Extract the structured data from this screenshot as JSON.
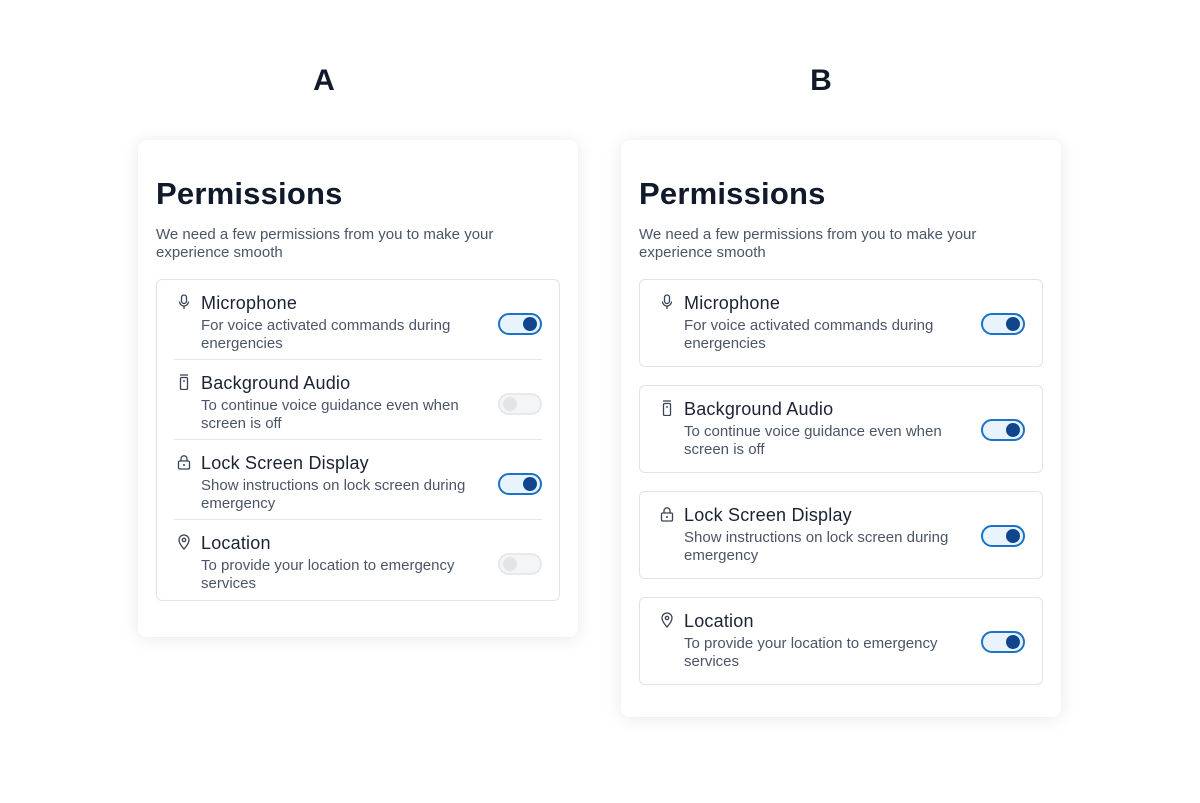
{
  "variants": [
    {
      "label": "A",
      "title": "Permissions",
      "subtitle": "We need a few permissions from you to make your experience smooth",
      "items": [
        {
          "name": "Microphone",
          "description": "For voice activated commands during energencies",
          "icon": "microphone-icon",
          "enabled": true
        },
        {
          "name": "Background Audio",
          "description": "To continue voice guidance even when screen is off",
          "icon": "speaker-icon",
          "enabled": false
        },
        {
          "name": "Lock Screen Display",
          "description": "Show instructions on lock screen during emergency",
          "icon": "lock-icon",
          "enabled": true
        },
        {
          "name": "Location",
          "description": "To provide your location to emergency services",
          "icon": "location-pin-icon",
          "enabled": false
        }
      ]
    },
    {
      "label": "B",
      "title": "Permissions",
      "subtitle": "We need a few permissions from you to make your experience smooth",
      "items": [
        {
          "name": "Microphone",
          "description": "For voice activated commands during energencies",
          "icon": "microphone-icon",
          "enabled": true
        },
        {
          "name": "Background Audio",
          "description": "To continue voice guidance even when screen is off",
          "icon": "speaker-icon",
          "enabled": true
        },
        {
          "name": "Lock Screen Display",
          "description": "Show instructions on lock screen during emergency",
          "icon": "lock-icon",
          "enabled": true
        },
        {
          "name": "Location",
          "description": "To provide your location to emergency services",
          "icon": "location-pin-icon",
          "enabled": true
        }
      ]
    }
  ],
  "colors": {
    "toggle_on_border": "#1a73c8",
    "toggle_on_knob": "#10468d",
    "toggle_off_border": "#e6e8ec"
  }
}
